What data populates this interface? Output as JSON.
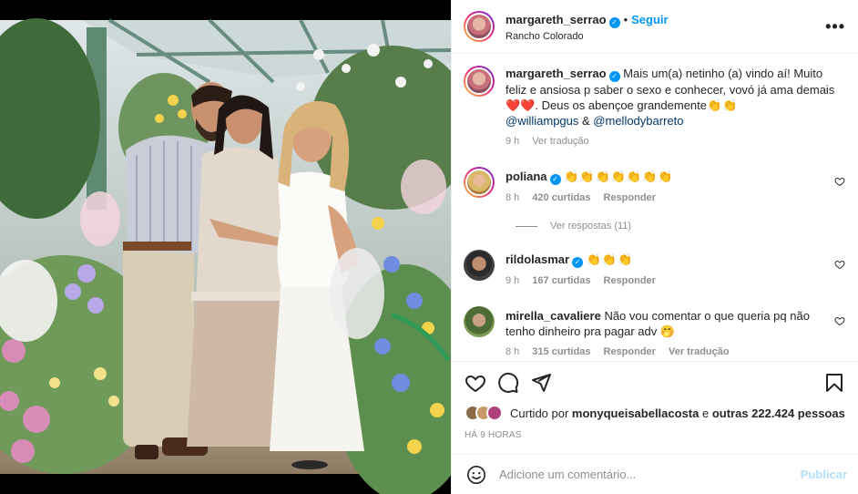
{
  "post": {
    "author": "margareth_serrao",
    "follow_label": "Seguir",
    "location": "Rancho Colorado",
    "separator": "•",
    "more_label": "•••"
  },
  "caption": {
    "username": "margareth_serrao",
    "text_1": "Mais um(a) netinho (a) vindo aí! Muito feliz e ansiosa p saber o sexo e conhecer, vovó já ama demais ",
    "hearts": "❤️❤️",
    "text_2": ". Deus os abençoe grandemente",
    "claps": "👏👏",
    "mention_1": "@williampgus",
    "amp": " & ",
    "mention_2": "@mellodybarreto",
    "time": "9 h",
    "translate": "Ver tradução"
  },
  "comments": [
    {
      "username": "poliana",
      "text": "",
      "emoji": "👏👏👏👏👏👏👏",
      "time": "8 h",
      "likes": "420 curtidas",
      "reply": "Responder",
      "translate": ""
    },
    {
      "username": "rildolasmar",
      "text": "",
      "emoji": "👏👏👏",
      "time": "9 h",
      "likes": "167 curtidas",
      "reply": "Responder",
      "translate": ""
    },
    {
      "username": "mirella_cavaliere",
      "text": "Não vou comentar o que queria pq não tenho dinheiro pra pagar adv ",
      "emoji": "🤭",
      "time": "8 h",
      "likes": "315 curtidas",
      "reply": "Responder",
      "translate": "Ver tradução"
    }
  ],
  "view_replies": "Ver respostas (11)",
  "likes": {
    "prefix": "Curtido por ",
    "user": "monyqueisabellacosta",
    "middle": " e ",
    "others": "outras 222.424 pessoas"
  },
  "posted_ago": "HÁ 9 HORAS",
  "add_comment": {
    "placeholder": "Adicione um comentário...",
    "publish": "Publicar"
  },
  "colors": {
    "accent": "#0095f6",
    "muted": "#8e8e8e",
    "publish_disabled": "#b2dffc"
  },
  "icons": [
    "verified-badge",
    "more-options-icon",
    "heart-icon",
    "comment-icon",
    "share-icon",
    "bookmark-icon",
    "emoji-icon"
  ]
}
